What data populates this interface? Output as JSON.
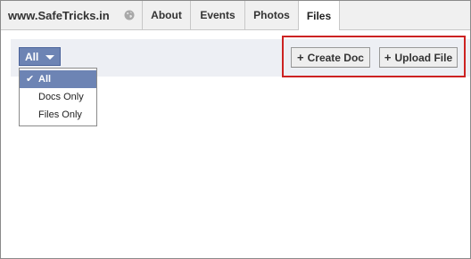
{
  "header": {
    "page_name": "www.SafeTricks.in",
    "tabs": [
      {
        "label": "About"
      },
      {
        "label": "Events"
      },
      {
        "label": "Photos"
      },
      {
        "label": "Files",
        "active": true
      }
    ]
  },
  "toolbar": {
    "filter": {
      "label": "All",
      "options": [
        {
          "label": "All",
          "selected": true
        },
        {
          "label": "Docs Only"
        },
        {
          "label": "Files Only"
        }
      ]
    },
    "create_doc_label": "Create Doc",
    "upload_file_label": "Upload File"
  },
  "icons": {
    "globe": "globe-icon",
    "dropdown": "chevron-down-icon",
    "plus": "plus-icon",
    "check": "check-icon"
  },
  "colors": {
    "accent": "#6d84b4",
    "toolbar_bg": "#edeff4",
    "highlight": "#cc2222"
  }
}
